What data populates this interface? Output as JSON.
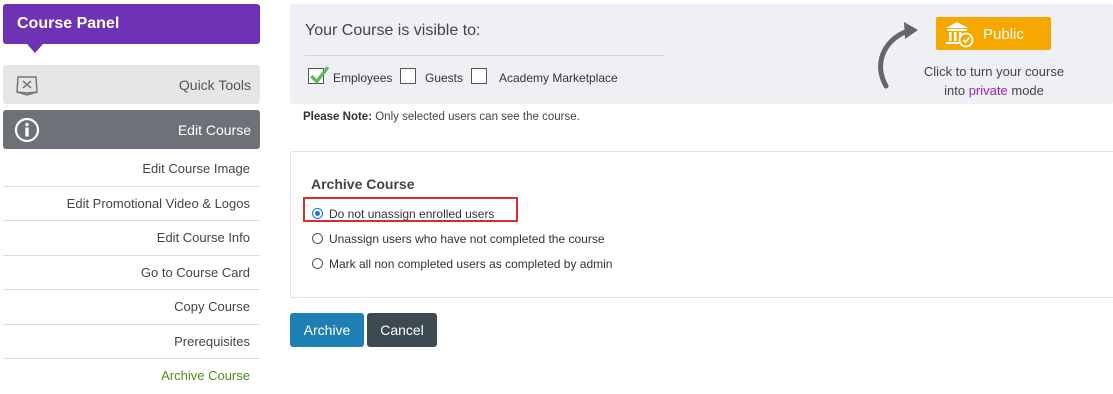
{
  "sidebar": {
    "title": "Course Panel",
    "quick_tools": "Quick Tools",
    "edit_course": "Edit Course",
    "items": [
      {
        "label": "Edit Course Image"
      },
      {
        "label": "Edit Promotional Video & Logos"
      },
      {
        "label": "Edit Course Info"
      },
      {
        "label": "Go to Course Card"
      },
      {
        "label": "Copy Course"
      },
      {
        "label": "Prerequisites"
      },
      {
        "label": "Archive Course",
        "active": true
      }
    ]
  },
  "visibility": {
    "title": "Your Course is visible to:",
    "options": [
      {
        "label": "Employees",
        "checked": true
      },
      {
        "label": "Guests",
        "checked": false
      },
      {
        "label": "Academy Marketplace",
        "checked": false
      }
    ],
    "public_button": "Public",
    "turn_text_1": "Click to turn your course",
    "turn_text_2a": "into",
    "turn_text_private": "private",
    "turn_text_2b": "mode"
  },
  "note": {
    "bold": "Please Note:",
    "text": "Only selected users can see the course."
  },
  "archive": {
    "title": "Archive Course",
    "options": [
      {
        "label": "Do not unassign enrolled users",
        "selected": true
      },
      {
        "label": "Unassign users who have not completed the course",
        "selected": false
      },
      {
        "label": "Mark all non completed users as completed by admin",
        "selected": false
      }
    ]
  },
  "buttons": {
    "archive": "Archive",
    "cancel": "Cancel"
  },
  "colors": {
    "panel": "#6e33b4",
    "edit_course_bg": "#6c7278",
    "public_button": "#f7a800",
    "archive_button": "#1e7fb5",
    "cancel_button": "#3e4a52",
    "highlight": "#d32f2f",
    "check": "#5cb85c",
    "active_link": "#4e8a1e",
    "private_text": "#9c27b0"
  },
  "icons": {
    "quick_tools": "quick-tools-icon",
    "edit_course": "info-icon",
    "public": "bank-check-icon",
    "turn": "curved-arrow-icon"
  }
}
